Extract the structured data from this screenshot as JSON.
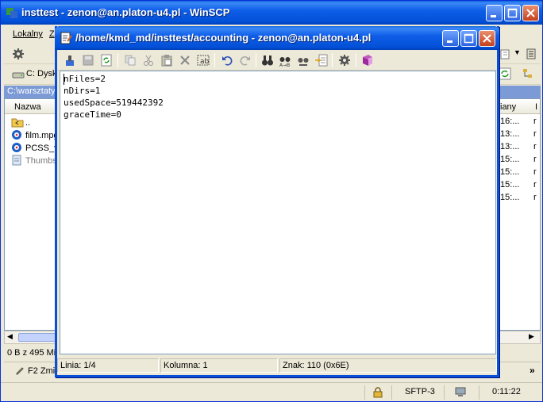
{
  "main_window": {
    "title": "insttest - zenon@an.platon-u4.pl - WinSCP",
    "menu": [
      "Lokalny",
      "Z"
    ],
    "local_drive": "C: Dysk",
    "local_path": "C:\\warsztaty",
    "left_panel": {
      "column_name": "Nazwa",
      "files": [
        {
          "name": "..",
          "icon": "parent-folder-icon"
        },
        {
          "name": "film.mpg",
          "icon": "media-file-icon"
        },
        {
          "name": "PCSS_v..",
          "icon": "media-file-icon"
        },
        {
          "name": "Thumbs..",
          "icon": "system-file-icon"
        }
      ]
    },
    "right_panel": {
      "column_header": "iany",
      "column_header2": "I",
      "times": [
        "16:...",
        "13:...",
        "13:...",
        "15:...",
        "15:...",
        "15:...",
        "15:..."
      ],
      "markers": [
        "r",
        "r",
        "r",
        "r",
        "r",
        "r",
        "r"
      ]
    },
    "left_status": "0 B z 495 Mi",
    "f2_label": "F2 Zmie",
    "more_label": "»",
    "status": {
      "protocol": "SFTP-3",
      "elapsed": "0:11:22"
    }
  },
  "editor": {
    "title": "/home/kmd_md/insttest/accounting - zenon@an.platon-u4.pl",
    "lines": [
      "nFiles=2",
      "nDirs=1",
      "usedSpace=519442392",
      "graceTime=0"
    ],
    "status": {
      "line": "Linia: 1/4",
      "column": "Kolumna: 1",
      "char": "Znak: 110 (0x6E)"
    }
  },
  "colors": {
    "titlebar": "#0250d6",
    "path_bar": "#7c9ad6",
    "close_button": "#c6401c"
  }
}
